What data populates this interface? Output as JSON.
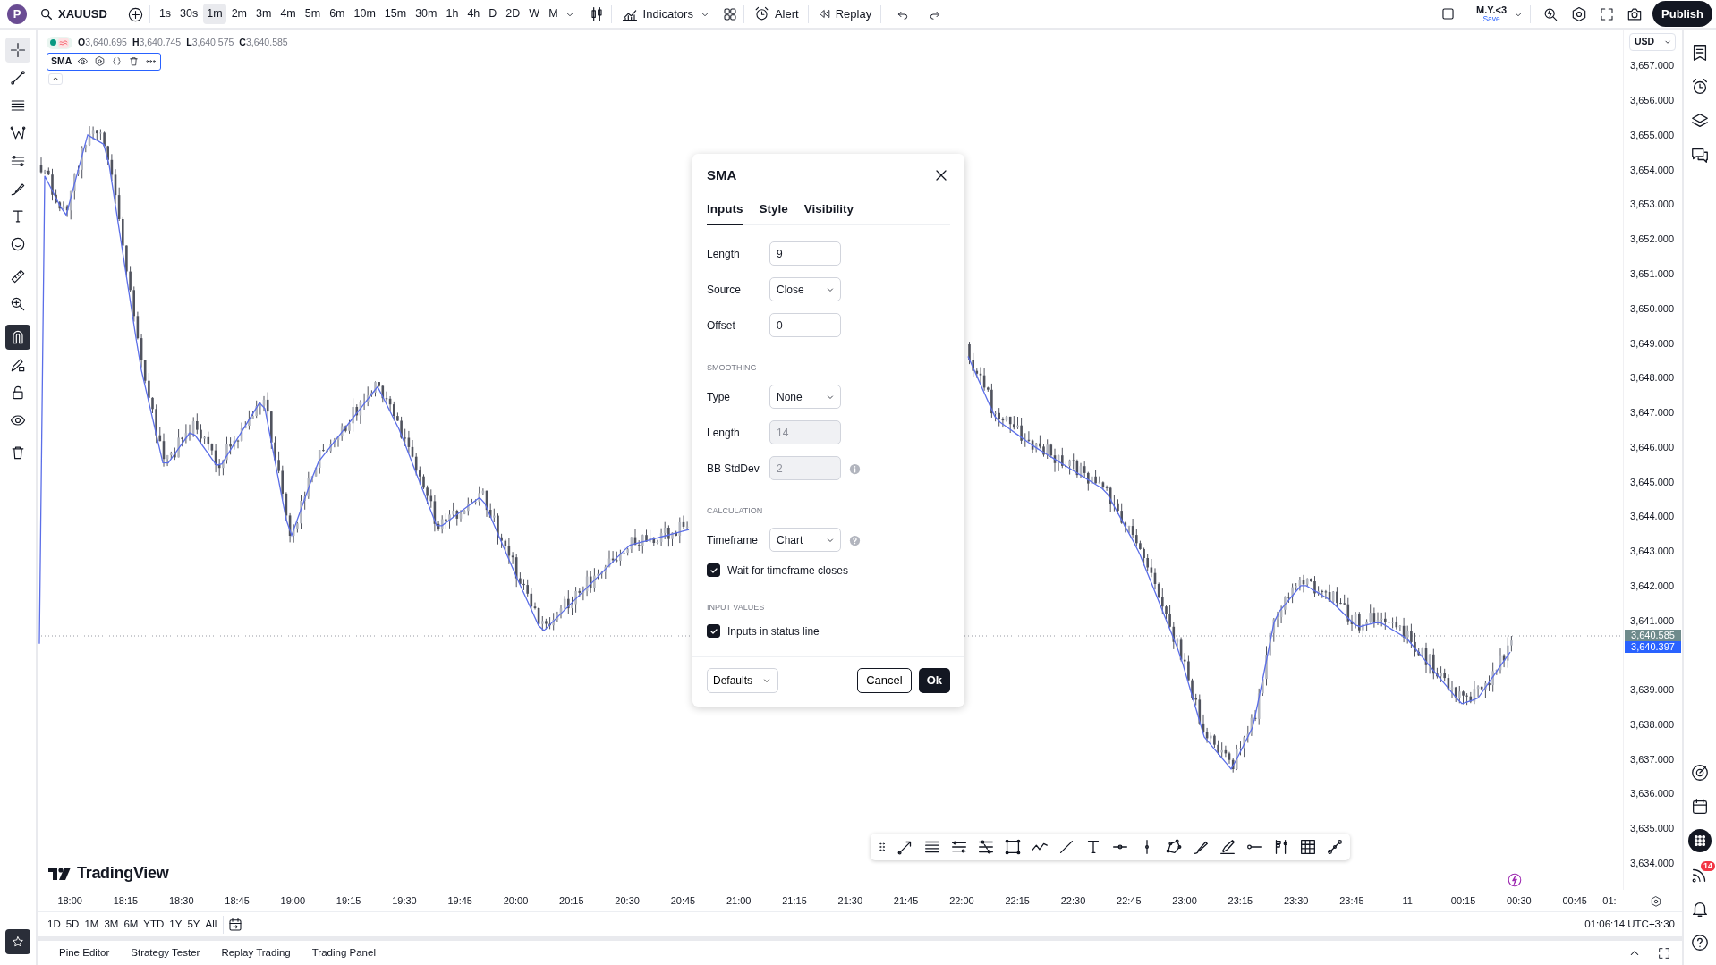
{
  "top_bar": {
    "avatar": "P",
    "symbol": "XAUUSD",
    "intervals": [
      {
        "label": "1s",
        "selected": false
      },
      {
        "label": "30s",
        "selected": false
      },
      {
        "label": "1m",
        "selected": true
      },
      {
        "label": "2m",
        "selected": false
      },
      {
        "label": "3m",
        "selected": false
      },
      {
        "label": "4m",
        "selected": false
      },
      {
        "label": "5m",
        "selected": false
      },
      {
        "label": "6m",
        "selected": false
      },
      {
        "label": "10m",
        "selected": false
      },
      {
        "label": "15m",
        "selected": false
      },
      {
        "label": "30m",
        "selected": false
      },
      {
        "label": "1h",
        "selected": false
      },
      {
        "label": "4h",
        "selected": false
      },
      {
        "label": "D",
        "selected": false
      },
      {
        "label": "2D",
        "selected": false
      },
      {
        "label": "W",
        "selected": false
      },
      {
        "label": "M",
        "selected": false
      }
    ],
    "indicators": "Indicators",
    "alert": "Alert",
    "replay": "Replay",
    "layout_name": "M.Y.<3",
    "save_label": "Save",
    "publish": "Publish"
  },
  "left_toolbar": [
    {
      "kind": "crosshair",
      "selected": true,
      "on": false
    },
    {
      "kind": "trendline",
      "selected": false,
      "on": false
    },
    {
      "kind": "fib",
      "selected": false,
      "on": false
    },
    {
      "kind": "pattern",
      "selected": false,
      "on": false
    },
    {
      "kind": "channel",
      "selected": false,
      "on": false
    },
    {
      "kind": "brush",
      "selected": false,
      "on": false
    },
    {
      "kind": "text",
      "selected": false,
      "on": false
    },
    {
      "kind": "smiley",
      "selected": false,
      "on": false
    },
    {
      "kind": "ruler",
      "selected": false,
      "on": false
    },
    {
      "kind": "zoom",
      "selected": false,
      "on": false
    },
    {
      "kind": "magnet",
      "selected": false,
      "on": true
    },
    {
      "kind": "pencil",
      "selected": false,
      "on": false
    },
    {
      "kind": "lock",
      "selected": false,
      "on": false
    },
    {
      "kind": "eye",
      "selected": false,
      "on": false
    },
    {
      "kind": "trash",
      "selected": false,
      "on": false
    }
  ],
  "legend": {
    "ohlc": [
      {
        "key": "O",
        "value": "3,640.695"
      },
      {
        "key": "H",
        "value": "3,640.745"
      },
      {
        "key": "L",
        "value": "3,640.575"
      },
      {
        "key": "C",
        "value": "3,640.585"
      }
    ],
    "indicator": "SMA"
  },
  "price_axis": {
    "currency": "USD",
    "ticks": [
      "3,657.000",
      "3,656.000",
      "3,655.000",
      "3,654.000",
      "3,653.000",
      "3,652.000",
      "3,651.000",
      "3,650.000",
      "3,649.000",
      "3,648.000",
      "3,647.000",
      "3,646.000",
      "3,645.000",
      "3,644.000",
      "3,643.000",
      "3,642.000",
      "3,641.000",
      "3,639.000",
      "3,638.000",
      "3,637.000",
      "3,636.000",
      "3,635.000",
      "3,634.000"
    ],
    "markers": [
      {
        "text": "3,640.585",
        "color": "#6f8b8c"
      },
      {
        "text": "3,640.397",
        "color": "#2962ff"
      }
    ]
  },
  "time_axis": {
    "ticks": [
      "18:00",
      "18:15",
      "18:30",
      "18:45",
      "19:00",
      "19:15",
      "19:30",
      "19:45",
      "20:00",
      "20:15",
      "20:30",
      "20:45",
      "21:00",
      "21:15",
      "21:30",
      "21:45",
      "22:00",
      "22:15",
      "22:30",
      "22:45",
      "23:00",
      "23:15",
      "23:30",
      "23:45",
      "11",
      "00:15",
      "00:30",
      "00:45",
      "01:"
    ]
  },
  "brand": "TradingView",
  "drawing_toolbar": [
    {
      "kind": "arrow"
    },
    {
      "kind": "hlines"
    },
    {
      "kind": "channel"
    },
    {
      "kind": "fibchannel"
    },
    {
      "kind": "rect"
    },
    {
      "kind": "path"
    },
    {
      "kind": "line"
    },
    {
      "kind": "text"
    },
    {
      "kind": "hray"
    },
    {
      "kind": "vline"
    },
    {
      "kind": "polygon"
    },
    {
      "kind": "brush"
    },
    {
      "kind": "highlighter"
    },
    {
      "kind": "hline"
    },
    {
      "kind": "flags"
    },
    {
      "kind": "grid"
    },
    {
      "kind": "measure"
    }
  ],
  "ranges": [
    "1D",
    "5D",
    "1M",
    "3M",
    "6M",
    "YTD",
    "1Y",
    "5Y",
    "All"
  ],
  "clock": "01:06:14 UTC+3:30",
  "bottom_tabs": [
    "Pine Editor",
    "Strategy Tester",
    "Replay Trading",
    "Trading Panel"
  ],
  "right_sidebar": [
    {
      "kind": "watchlist"
    },
    {
      "kind": "alarm"
    },
    {
      "kind": "layers"
    },
    {
      "kind": "chat"
    },
    {
      "kind": "gap"
    },
    {
      "kind": "target"
    },
    {
      "kind": "calendar"
    },
    {
      "kind": "apps"
    },
    {
      "kind": "signal",
      "badge": "14"
    },
    {
      "kind": "bell"
    },
    {
      "kind": "help"
    }
  ],
  "dialog": {
    "title": "SMA",
    "tabs": [
      {
        "label": "Inputs",
        "selected": true
      },
      {
        "label": "Style",
        "selected": false
      },
      {
        "label": "Visibility",
        "selected": false
      }
    ],
    "rows": [
      {
        "kind": "input",
        "label": "Length",
        "value": "9",
        "disabled": false,
        "info": false,
        "help": false
      },
      {
        "kind": "select",
        "label": "Source",
        "value": "Close",
        "info": false,
        "help": false
      },
      {
        "kind": "input",
        "label": "Offset",
        "value": "0",
        "disabled": false,
        "info": false,
        "help": false
      },
      {
        "kind": "heading",
        "text": "SMOOTHING"
      },
      {
        "kind": "select",
        "label": "Type",
        "value": "None",
        "info": false,
        "help": false
      },
      {
        "kind": "input",
        "label": "Length",
        "value": "14",
        "disabled": true,
        "info": false,
        "help": false
      },
      {
        "kind": "input",
        "label": "BB StdDev",
        "value": "2",
        "disabled": true,
        "info": true,
        "help": false
      },
      {
        "kind": "heading",
        "text": "CALCULATION"
      },
      {
        "kind": "select",
        "label": "Timeframe",
        "value": "Chart",
        "info": false,
        "help": true
      },
      {
        "kind": "checkbox",
        "label": "Wait for timeframe closes",
        "checked": true
      },
      {
        "kind": "heading",
        "text": "INPUT VALUES"
      },
      {
        "kind": "checkbox",
        "label": "Inputs in status line",
        "checked": true
      }
    ],
    "defaults": "Defaults",
    "cancel": "Cancel",
    "ok": "Ok"
  }
}
